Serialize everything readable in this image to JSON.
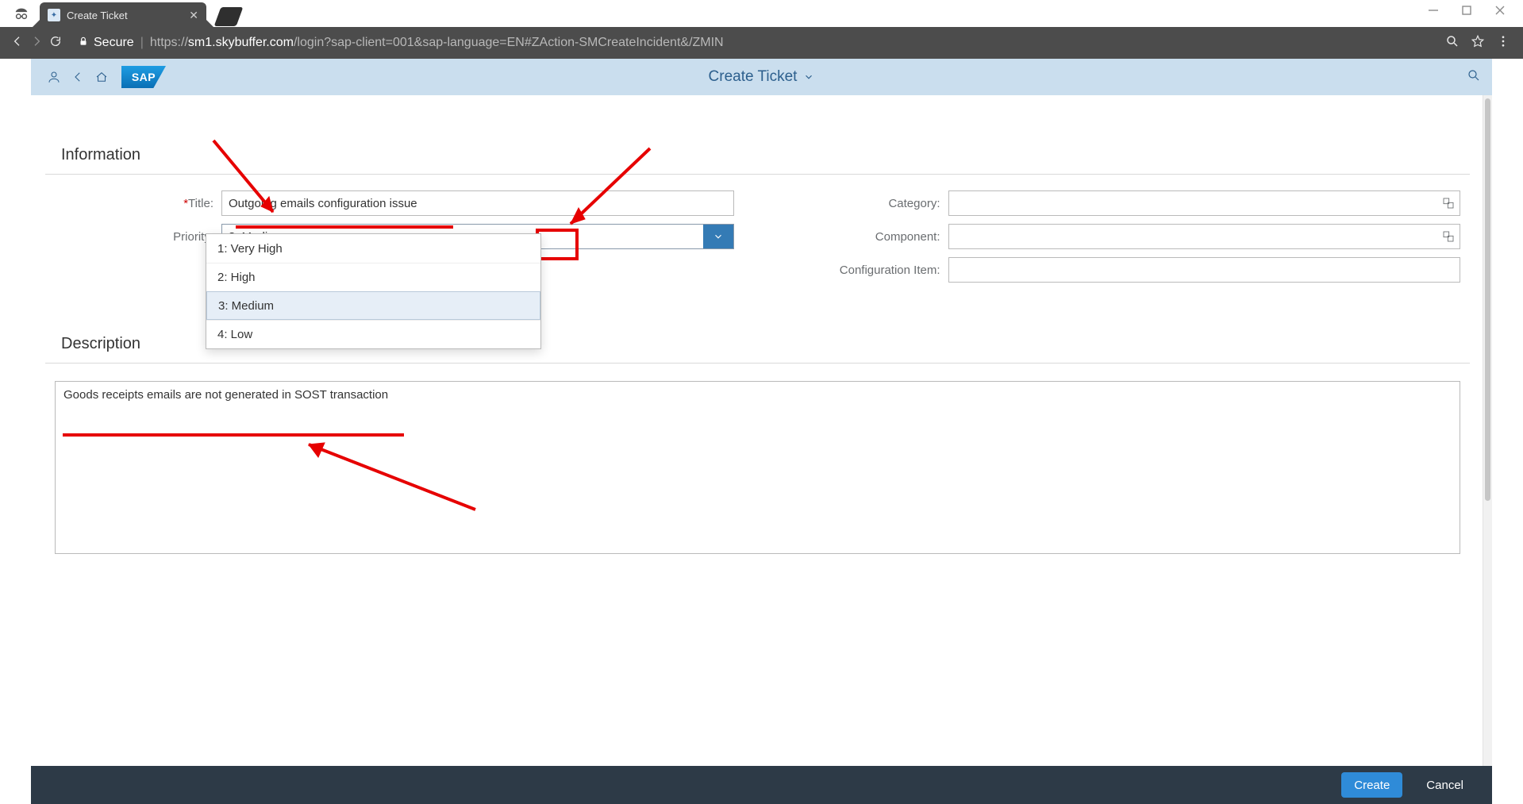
{
  "browser": {
    "tab_title": "Create Ticket",
    "secure_label": "Secure",
    "url_scheme": "https://",
    "url_host": "sm1.skybuffer.com",
    "url_path": "/login?sap-client=001&sap-language=EN#ZAction-SMCreateIncident&/ZMIN"
  },
  "shell": {
    "logo_text": "SAP",
    "page_title": "Create Ticket"
  },
  "sections": {
    "info": "Information",
    "desc": "Description"
  },
  "fields": {
    "title_label": "Title:",
    "title_value": "Outgoing emails configuration issue",
    "priority_label": "Priority:",
    "priority_value": "3: Medium",
    "priority_options": [
      "1: Very High",
      "2: High",
      "3: Medium",
      "4: Low"
    ],
    "category_label": "Category:",
    "category_value": "",
    "component_label": "Component:",
    "component_value": "",
    "configitem_label": "Configuration Item:",
    "configitem_value": ""
  },
  "description_value": "Goods receipts emails are not generated in SOST transaction",
  "footer": {
    "create": "Create",
    "cancel": "Cancel"
  }
}
